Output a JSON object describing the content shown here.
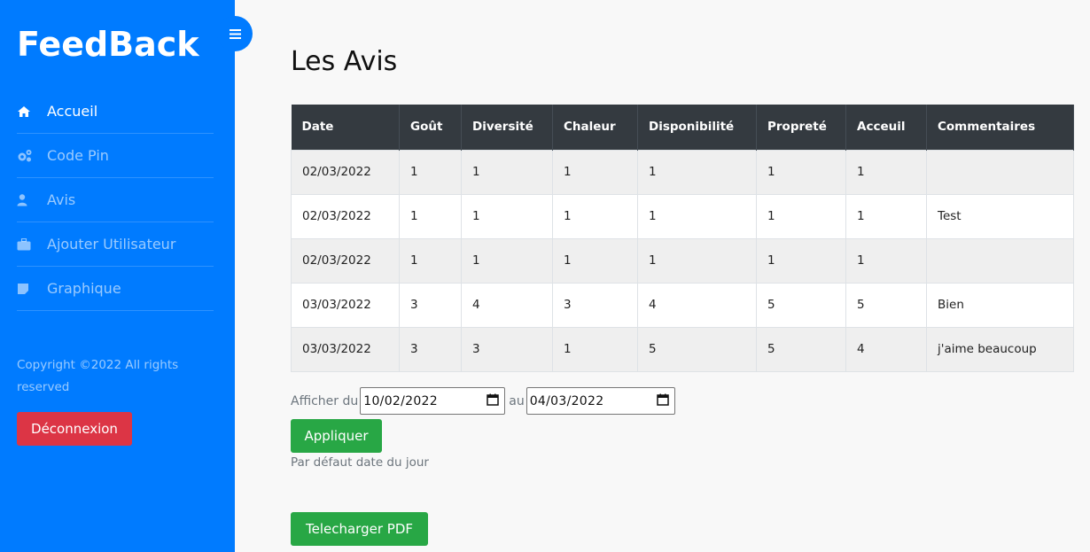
{
  "sidebar": {
    "brand": "FeedBack",
    "items": [
      {
        "label": "Accueil",
        "icon": "home-icon",
        "active": true
      },
      {
        "label": "Code Pin",
        "icon": "cogs-icon",
        "active": false
      },
      {
        "label": "Avis",
        "icon": "user-icon",
        "active": false
      },
      {
        "label": "Ajouter Utilisateur",
        "icon": "briefcase-icon",
        "active": false
      },
      {
        "label": "Graphique",
        "icon": "sticky-note-icon",
        "active": false
      }
    ],
    "copyright": "Copyright ©2022 All rights reserved",
    "logout_label": "Déconnexion"
  },
  "colors": {
    "sidebar": "#007bff",
    "table_header": "#343a40",
    "danger": "#dc3545",
    "success": "#28a745"
  },
  "main": {
    "title": "Les Avis",
    "table": {
      "headers": [
        "Date",
        "Goût",
        "Diversité",
        "Chaleur",
        "Disponibilité",
        "Propreté",
        "Acceuil",
        "Commentaires"
      ],
      "rows": [
        [
          "02/03/2022",
          "1",
          "1",
          "1",
          "1",
          "1",
          "1",
          ""
        ],
        [
          "02/03/2022",
          "1",
          "1",
          "1",
          "1",
          "1",
          "1",
          "Test"
        ],
        [
          "02/03/2022",
          "1",
          "1",
          "1",
          "1",
          "1",
          "1",
          ""
        ],
        [
          "03/03/2022",
          "3",
          "4",
          "3",
          "4",
          "5",
          "5",
          "Bien"
        ],
        [
          "03/03/2022",
          "3",
          "3",
          "1",
          "5",
          "5",
          "4",
          "j'aime beaucoup"
        ]
      ]
    },
    "filter": {
      "from_label": "Afficher du",
      "from_value": "10/02/2022",
      "to_label": "au",
      "to_value": "04/03/2022",
      "apply_label": "Appliquer",
      "hint": "Par défaut date du jour"
    },
    "pdf_label": "Telecharger PDF"
  }
}
